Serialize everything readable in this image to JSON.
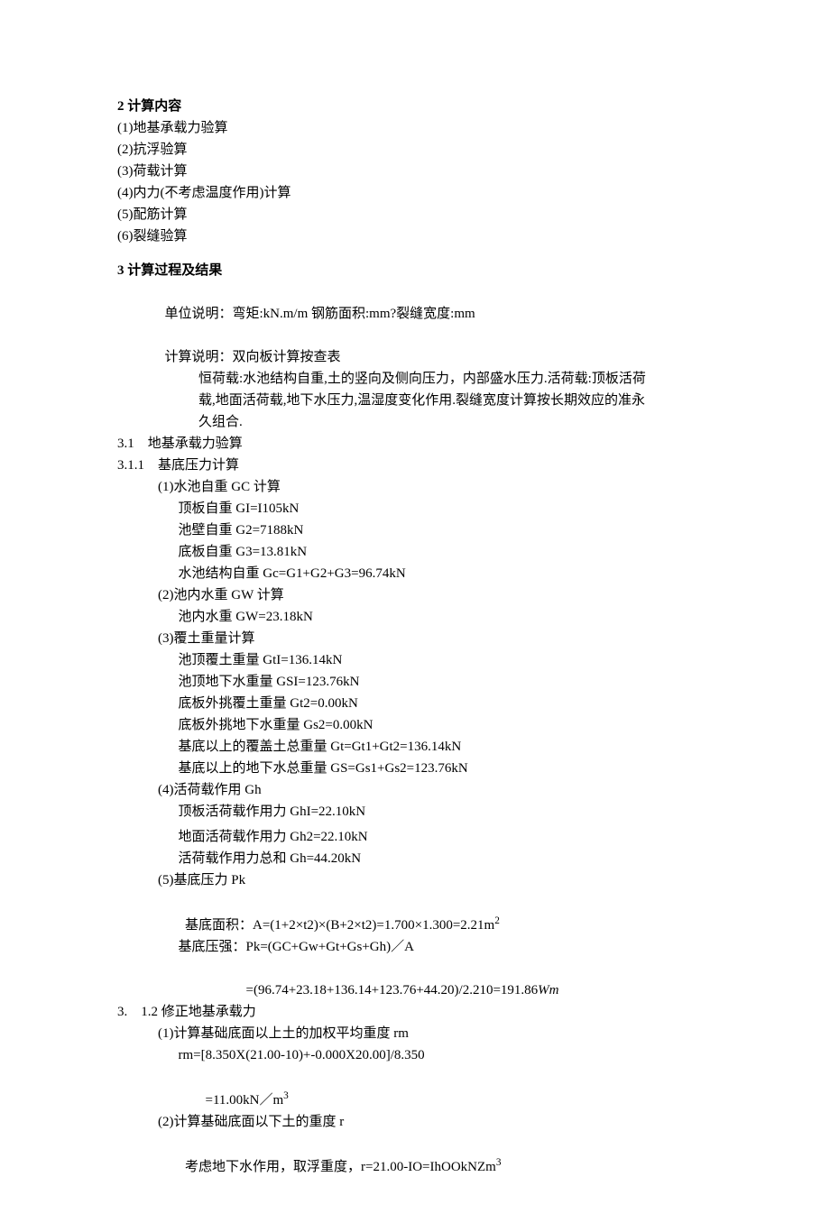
{
  "s2": {
    "title": "2 计算内容",
    "items": [
      "(1)地基承载力验算",
      "(2)抗浮验算",
      "(3)荷载计算",
      "(4)内力(不考虑温度作用)计算",
      "(5)配筋计算",
      "(6)裂缝验算"
    ]
  },
  "s3": {
    "title": "3 计算过程及结果",
    "unit_label": "单位说明：",
    "unit_text": "弯矩:kN.m/m 钢筋面积:mm?裂缝宽度:mm",
    "calc_label": "计算说明：",
    "calc_text_a": "双向板计算按查表",
    "calc_text_b1": "恒荷载:水池结构自重,土的竖向及侧向压力，内部盛水压力.活荷载:顶板活荷",
    "calc_text_b2": "载,地面活荷载,地下水压力,温湿度变化作用.裂缝宽度计算按长期效应的准永",
    "calc_text_b3": "久组合.",
    "s31": {
      "title": "3.1　地基承载力验算",
      "s311": {
        "title": "3.1.1　基底压力计算",
        "p1": {
          "head": "(1)水池自重 GC 计算",
          "l1": "顶板自重 GI=I105kN",
          "l2": "池壁自重 G2=7188kN",
          "l3": "底板自重 G3=13.81kN",
          "l4": "水池结构自重 Gc=G1+G2+G3=96.74kN"
        },
        "p2": {
          "head": "(2)池内水重 GW 计算",
          "l1": "池内水重 GW=23.18kN"
        },
        "p3": {
          "head": "(3)覆土重量计算",
          "l1": "池顶覆土重量 GtI=136.14kN",
          "l2": "池顶地下水重量 GSI=123.76kN",
          "l3": "底板外挑覆土重量 Gt2=0.00kN",
          "l4": "底板外挑地下水重量 Gs2=0.00kN",
          "l5": "基底以上的覆盖土总重量 Gt=Gt1+Gt2=136.14kN",
          "l6": "基底以上的地下水总重量 GS=Gs1+Gs2=123.76kN"
        },
        "p4": {
          "head": "(4)活荷载作用 Gh",
          "l1": "顶板活荷载作用力 GhI=22.10kN",
          "l2": "地面活荷载作用力 Gh2=22.10kN",
          "l3": "活荷载作用力总和 Gh=44.20kN"
        },
        "p5": {
          "head": "(5)基底压力 Pk",
          "l1a": "基底面积：A=(1+2×t2)×(B+2×t2)=1.700×1.300=2.21m",
          "l1b": "2",
          "l2": "基底压强：Pk=(GC+Gw+Gt+Gs+Gh)／A",
          "l3a": "=(96.74+23.18+136.14+123.76+44.20)/2.210=191.86",
          "l3b": "Wm"
        }
      },
      "s312": {
        "title": "3.　1.2 修正地基承载力",
        "p1": {
          "head": "(1)计算基础底面以上土的加权平均重度 rm",
          "l1": "rm=[8.350X(21.00-10)+-0.000X20.00]/8.350",
          "l2a": "=11.00kN／m",
          "l2b": "3"
        },
        "p2": {
          "head": "(2)计算基础底面以下土的重度 r",
          "l1a": "考虑地下水作用，取浮重度，r=21.00-IO=IhOOkNZm",
          "l1b": "3"
        }
      }
    }
  }
}
